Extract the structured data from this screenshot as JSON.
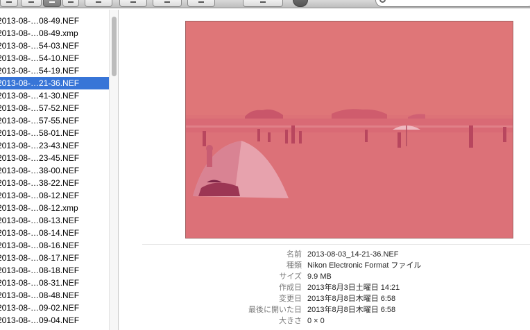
{
  "files": [
    {
      "name": "2013-08-…08-49.NEF",
      "selected": false
    },
    {
      "name": "2013-08-…08-49.xmp",
      "selected": false
    },
    {
      "name": "2013-08-…54-03.NEF",
      "selected": false
    },
    {
      "name": "2013-08-…54-10.NEF",
      "selected": false
    },
    {
      "name": "2013-08-…54-19.NEF",
      "selected": false
    },
    {
      "name": "2013-08-…21-36.NEF",
      "selected": true
    },
    {
      "name": "2013-08-…41-30.NEF",
      "selected": false
    },
    {
      "name": "2013-08-…57-52.NEF",
      "selected": false
    },
    {
      "name": "2013-08-…57-55.NEF",
      "selected": false
    },
    {
      "name": "2013-08-…58-01.NEF",
      "selected": false
    },
    {
      "name": "2013-08-…23-43.NEF",
      "selected": false
    },
    {
      "name": "2013-08-…23-45.NEF",
      "selected": false
    },
    {
      "name": "2013-08-…38-00.NEF",
      "selected": false
    },
    {
      "name": "2013-08-…38-22.NEF",
      "selected": false
    },
    {
      "name": "2013-08-…08-12.NEF",
      "selected": false
    },
    {
      "name": "2013-08-…08-12.xmp",
      "selected": false
    },
    {
      "name": "2013-08-…08-13.NEF",
      "selected": false
    },
    {
      "name": "2013-08-…08-14.NEF",
      "selected": false
    },
    {
      "name": "2013-08-…08-16.NEF",
      "selected": false
    },
    {
      "name": "2013-08-…08-17.NEF",
      "selected": false
    },
    {
      "name": "2013-08-…08-18.NEF",
      "selected": false
    },
    {
      "name": "2013-08-…08-31.NEF",
      "selected": false
    },
    {
      "name": "2013-08-…08-48.NEF",
      "selected": false
    },
    {
      "name": "2013-08-…09-02.NEF",
      "selected": false
    },
    {
      "name": "2013-08-…09-04.NEF",
      "selected": false
    }
  ],
  "info": {
    "labels": {
      "name": "名前",
      "kind": "種類",
      "size": "サイズ",
      "created": "作成日",
      "modified": "変更日",
      "last_opened": "最後に開いた日",
      "dimensions": "大きさ"
    },
    "values": {
      "name": "2013-08-03_14-21-36.NEF",
      "kind": "Nikon Electronic Format ファイル",
      "size": "9.9 MB",
      "created": "2013年8月3日土曜日 14:21",
      "modified": "2013年8月8日木曜日 6:58",
      "last_opened": "2013年8月8日木曜日 6:58",
      "dimensions": "0 × 0"
    }
  },
  "colors": {
    "selection": "#3875d7",
    "preview_tint": "#dd7277"
  },
  "icons": {
    "view_icon": "icon-view-icon",
    "view_list": "list-view-icon",
    "view_columns": "column-view-icon",
    "view_coverflow": "coverflow-view-icon",
    "arrange": "arrange-icon",
    "action": "gear-icon",
    "dropbox": "dropbox-icon",
    "share": "share-icon",
    "tags": "tag-icon",
    "help": "help-icon",
    "search": "search-icon"
  }
}
